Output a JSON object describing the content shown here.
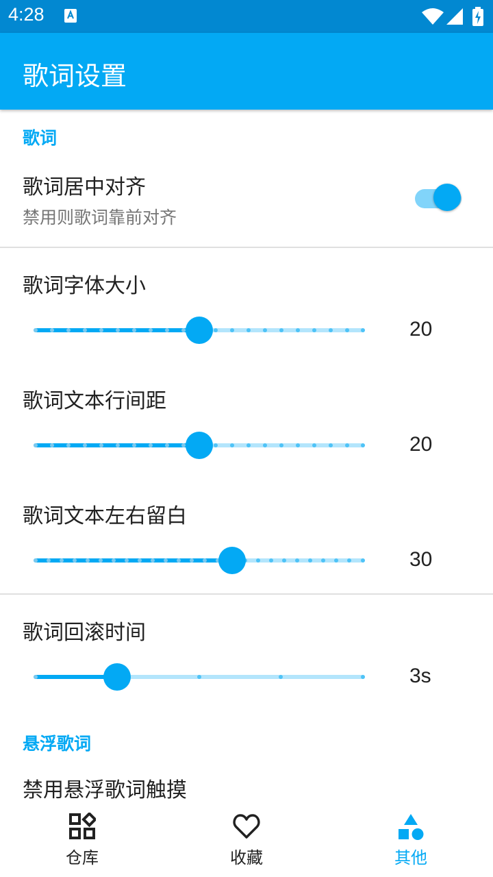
{
  "status_bar": {
    "time": "4:28"
  },
  "app_bar": {
    "title": "歌词设置"
  },
  "sections": {
    "lyrics": {
      "header": "歌词",
      "center_align": {
        "title": "歌词居中对齐",
        "summary": "禁用则歌词靠前对齐",
        "enabled": true
      },
      "font_size": {
        "title": "歌词字体大小",
        "value": "20"
      },
      "line_spacing": {
        "title": "歌词文本行间距",
        "value": "20"
      },
      "side_padding": {
        "title": "歌词文本左右留白",
        "value": "30"
      },
      "rollback_time": {
        "title": "歌词回滚时间",
        "value": "3s"
      }
    },
    "floating": {
      "header": "悬浮歌词",
      "disable_touch": {
        "title": "禁用悬浮歌词触摸"
      }
    }
  },
  "bottom_nav": {
    "items": [
      {
        "label": "仓库",
        "icon": "library-icon"
      },
      {
        "label": "收藏",
        "icon": "heart-icon"
      },
      {
        "label": "其他",
        "icon": "shapes-icon"
      }
    ],
    "active_index": 2
  },
  "colors": {
    "accent": "#03a9f4",
    "status_bar": "#0288d1",
    "track_inactive": "#b3e5fc"
  }
}
